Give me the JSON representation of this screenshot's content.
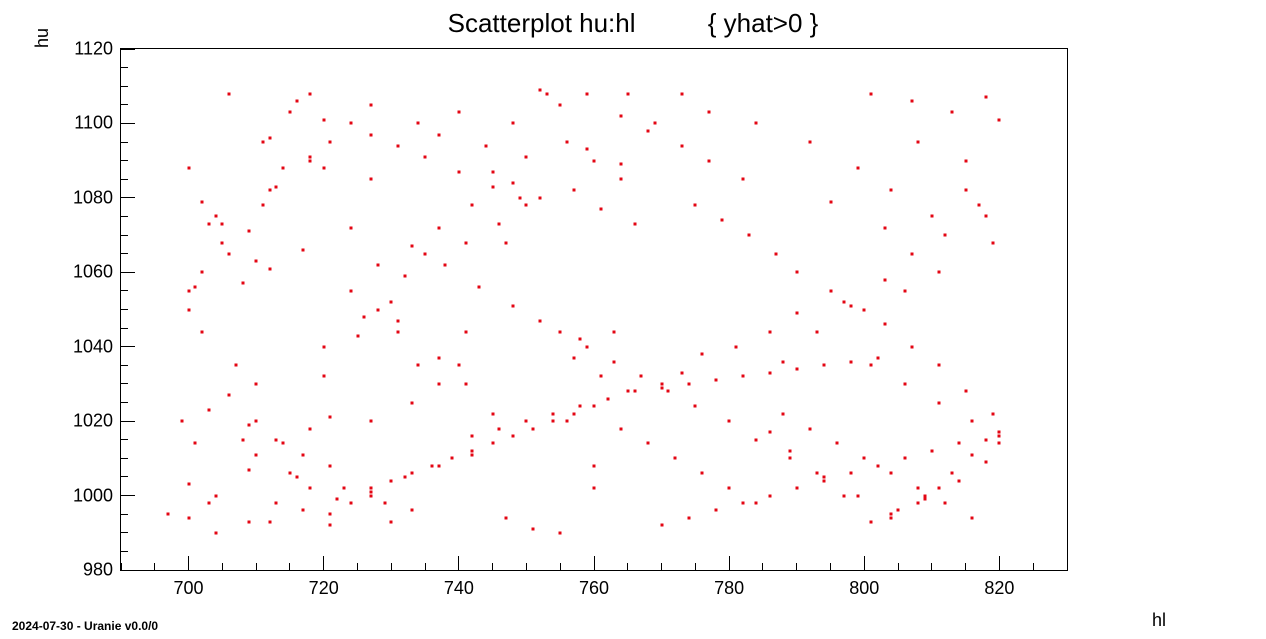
{
  "chart_data": {
    "type": "scatter",
    "title": "Scatterplot hu:hl          { yhat>0 }",
    "xlabel": "hl",
    "ylabel": "hu",
    "xlim": [
      690,
      830
    ],
    "ylim": [
      980,
      1120
    ],
    "xticks": [
      700,
      720,
      740,
      760,
      780,
      800,
      820
    ],
    "yticks": [
      980,
      1000,
      1020,
      1040,
      1060,
      1080,
      1100,
      1120
    ],
    "x": [
      706,
      716,
      752,
      765,
      773,
      740,
      734,
      720,
      700,
      711,
      727,
      718,
      702,
      724,
      749,
      703,
      755,
      748,
      737,
      759,
      744,
      764,
      769,
      777,
      784,
      792,
      801,
      807,
      813,
      818,
      820,
      808,
      815,
      799,
      804,
      795,
      810,
      817,
      819,
      803,
      811,
      806,
      797,
      790,
      786,
      781,
      776,
      773,
      770,
      700,
      703,
      710,
      715,
      697,
      704,
      709,
      713,
      718,
      721,
      707,
      710,
      706,
      703,
      709,
      714,
      717,
      721,
      716,
      723,
      727,
      729,
      733,
      720,
      725,
      731,
      708,
      712,
      717,
      724,
      728,
      731,
      737,
      741,
      745,
      728,
      733,
      737,
      742,
      748,
      752,
      745,
      750,
      757,
      761,
      766,
      756,
      760,
      764,
      759,
      764,
      768,
      773,
      777,
      782,
      775,
      779,
      783,
      787,
      790,
      795,
      800,
      803,
      807,
      811,
      815,
      819,
      820,
      816,
      813,
      809,
      805,
      801,
      797,
      793,
      789,
      786,
      801,
      806,
      811,
      816,
      820,
      818,
      814,
      809,
      804,
      799,
      794,
      789,
      784,
      780,
      775,
      771,
      767,
      763,
      759,
      755,
      751,
      747,
      712,
      717,
      722,
      727,
      732,
      737,
      742,
      700,
      704,
      709,
      713,
      718,
      700,
      702,
      701,
      702,
      706,
      705,
      710,
      709,
      712,
      712,
      715,
      718,
      721,
      724,
      727,
      730,
      733,
      736,
      739,
      742,
      745,
      748,
      751,
      754,
      757,
      760,
      742,
      746,
      750,
      754,
      758,
      762,
      766,
      770,
      774,
      778,
      782,
      786,
      790,
      794,
      798,
      802,
      770,
      774,
      778,
      782,
      786,
      790,
      794,
      798,
      802,
      806,
      810,
      814,
      818,
      820,
      816,
      812,
      808,
      804,
      800,
      796,
      792,
      788,
      784,
      780,
      776,
      772,
      768,
      764,
      760,
      756,
      763,
      760,
      755,
      708,
      714,
      721,
      727,
      734,
      741,
      747,
      753,
      700,
      710,
      720,
      730,
      740,
      699,
      701,
      704,
      705,
      711,
      713,
      718,
      720,
      721,
      724,
      726,
      730,
      732,
      735,
      737,
      733,
      727,
      727,
      731,
      735,
      740,
      745,
      750,
      746,
      741,
      738,
      743,
      748,
      752,
      758,
      757,
      761,
      765,
      804,
      808,
      811,
      815,
      818,
      812,
      807,
      803,
      798,
      793,
      788
    ],
    "y": [
      1108,
      1106,
      1109,
      1108,
      1108,
      1103,
      1100,
      1101,
      1088,
      1095,
      1085,
      1090,
      1079,
      1072,
      1080,
      1073,
      1105,
      1100,
      1097,
      1093,
      1094,
      1089,
      1100,
      1103,
      1100,
      1095,
      1108,
      1106,
      1103,
      1107,
      1101,
      1095,
      1090,
      1088,
      1082,
      1079,
      1075,
      1078,
      1068,
      1072,
      1060,
      1055,
      1052,
      1049,
      1044,
      1040,
      1038,
      1033,
      1030,
      1003,
      998,
      1011,
      1006,
      995,
      1000,
      1007,
      1015,
      1018,
      1021,
      1035,
      1030,
      1027,
      1023,
      1019,
      1014,
      1011,
      1008,
      1005,
      1002,
      1000,
      998,
      996,
      1040,
      1043,
      1047,
      1057,
      1061,
      1066,
      1055,
      1050,
      1044,
      1037,
      1030,
      1022,
      1062,
      1067,
      1072,
      1078,
      1084,
      1080,
      1087,
      1091,
      1082,
      1077,
      1073,
      1095,
      1090,
      1085,
      1108,
      1102,
      1098,
      1094,
      1090,
      1085,
      1078,
      1074,
      1070,
      1065,
      1060,
      1055,
      1050,
      1046,
      1040,
      1035,
      1028,
      1022,
      1017,
      1011,
      1006,
      1000,
      996,
      993,
      1000,
      1006,
      1012,
      1017,
      1035,
      1030,
      1025,
      1020,
      1014,
      1009,
      1004,
      999,
      995,
      1000,
      1005,
      1010,
      1015,
      1020,
      1024,
      1028,
      1032,
      1036,
      1040,
      1044,
      991,
      994,
      993,
      996,
      999,
      1002,
      1005,
      1008,
      1011,
      994,
      990,
      993,
      998,
      1002,
      1050,
      1044,
      1056,
      1060,
      1065,
      1073,
      1063,
      1071,
      1082,
      1096,
      1103,
      1108,
      995,
      998,
      1001,
      1004,
      1006,
      1008,
      1010,
      1012,
      1014,
      1016,
      1018,
      1020,
      1022,
      1024,
      1016,
      1018,
      1020,
      1022,
      1024,
      1026,
      1028,
      1029,
      1030,
      1031,
      1032,
      1033,
      1034,
      1035,
      1036,
      1037,
      992,
      994,
      996,
      998,
      1000,
      1002,
      1004,
      1006,
      1008,
      1010,
      1012,
      1014,
      1015,
      1016,
      994,
      998,
      1002,
      1006,
      1010,
      1014,
      1018,
      1022,
      998,
      1002,
      1006,
      1010,
      1014,
      1018,
      1008,
      1020,
      1044,
      1002,
      990,
      1015,
      1088,
      992,
      1105,
      1035,
      1044,
      1068,
      1108,
      1055,
      1020,
      1032,
      993,
      1035,
      1020,
      1014,
      1075,
      1068,
      1078,
      1083,
      1091,
      1088,
      1095,
      1100,
      1048,
      1052,
      1059,
      1065,
      1030,
      1025,
      1020,
      1097,
      1094,
      1091,
      1087,
      1083,
      1078,
      1073,
      1068,
      1062,
      1056,
      1051,
      1047,
      1042,
      1037,
      1032,
      1028,
      994,
      998,
      1002,
      1082,
      1075,
      1070,
      1065,
      1058,
      1051,
      1044,
      1036,
      1040,
      1050,
      1060,
      1070,
      1080,
      1033,
      1029,
      1026,
      1021,
      1018,
      1013,
      1010,
      1006,
      1003,
      999,
      995,
      991,
      1004,
      997,
      990,
      1060,
      1055,
      1050,
      1045,
      1040,
      1035
    ],
    "marker_color": "#e30613"
  },
  "footer": "2024-07-30 - Uranie v0.0/0"
}
